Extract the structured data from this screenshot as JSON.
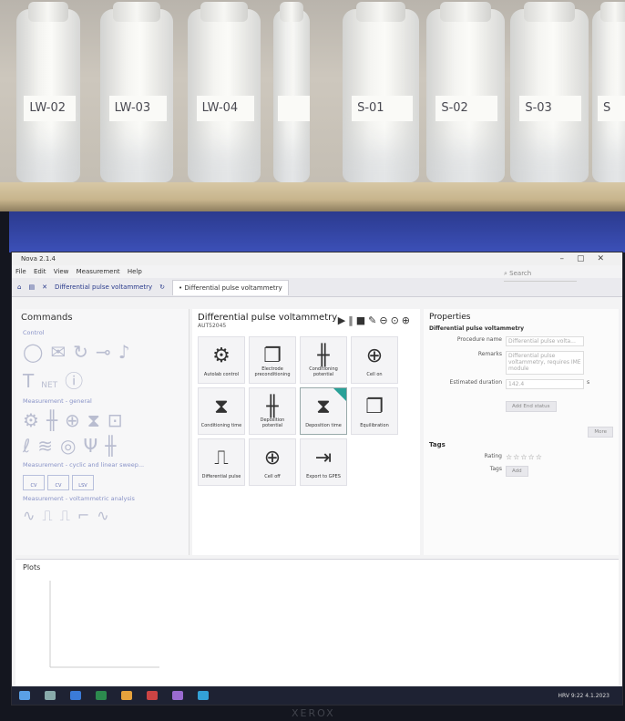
{
  "bottles": [
    {
      "label": "LW-02"
    },
    {
      "label": "LW-03"
    },
    {
      "label": "LW-04"
    },
    {
      "label": ""
    },
    {
      "label": "S-01"
    },
    {
      "label": "S-02"
    },
    {
      "label": "S-03"
    },
    {
      "label": "S"
    }
  ],
  "app": {
    "window_title": "Nova 2.1.4",
    "menu": [
      "File",
      "Edit",
      "View",
      "Measurement",
      "Help"
    ],
    "search_placeholder": "Search",
    "tabs": [
      "Differential pulse voltammetry",
      "• Differential pulse voltammetry"
    ]
  },
  "commands": {
    "title": "Commands",
    "sections": [
      "Control",
      "Measurement - general",
      "Measurement - cyclic and linear sweep...",
      "Measurement - voltammetric analysis"
    ],
    "control_net": "NET",
    "sweep_items": [
      "CV",
      "CV",
      "LSV"
    ]
  },
  "procedure": {
    "title": "Differential pulse voltammetry",
    "instrument": "AUT52045",
    "tiles": [
      {
        "label": "Autolab control",
        "icon": "gear-icon"
      },
      {
        "label": "Electrode preconditioning",
        "icon": "copy-icon"
      },
      {
        "label": "Conditioning potential",
        "icon": "potential-icon"
      },
      {
        "label": "Cell on",
        "icon": "cell-icon"
      },
      {
        "label": "Conditioning time",
        "icon": "hourglass-icon"
      },
      {
        "label": "Deposition potential",
        "icon": "potential-icon"
      },
      {
        "label": "Deposition time",
        "icon": "hourglass-icon"
      },
      {
        "label": "Equilibration",
        "icon": "copy-icon"
      },
      {
        "label": "Differential pulse",
        "icon": "pulse-icon"
      },
      {
        "label": "Cell off",
        "icon": "cell-icon"
      },
      {
        "label": "Export to GPES",
        "icon": "export-icon"
      }
    ]
  },
  "properties": {
    "title": "Properties",
    "subtitle": "Differential pulse voltammetry",
    "procedure_name_label": "Procedure name",
    "procedure_name_value": "Differential pulse volta...",
    "remarks_label": "Remarks",
    "remarks_value": "Differential pulse voltammetry, requires IME module",
    "estimated_duration_label": "Estimated duration",
    "estimated_duration_value": "142.4",
    "estimated_duration_unit": "s",
    "add_end_status": "Add End status",
    "more": "More",
    "tags_heading": "Tags",
    "rating_label": "Rating",
    "tags_label": "Tags",
    "add_button": "Add"
  },
  "plots": {
    "title": "Plots"
  },
  "taskbar": {
    "time": "9:22",
    "date": "4.1.2023",
    "lang": "HRV"
  },
  "monitor_brand": "XEROX"
}
